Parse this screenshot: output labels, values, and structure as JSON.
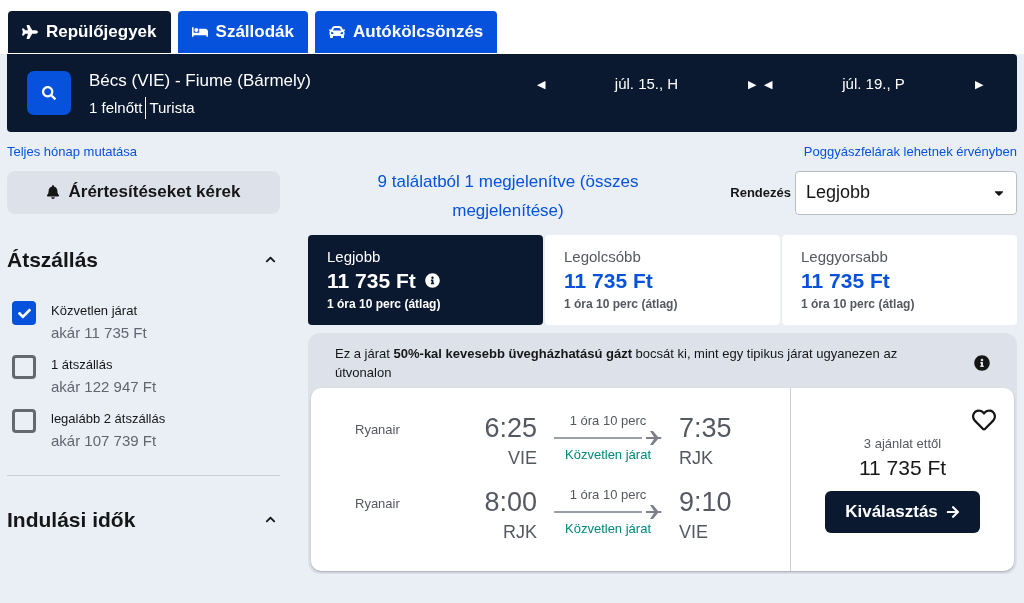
{
  "tabs": [
    {
      "label": "Repülőjegyek",
      "kind": "plane",
      "selected": true
    },
    {
      "label": "Szállodák",
      "kind": "bed",
      "selected": false
    },
    {
      "label": "Autókölcsönzés",
      "kind": "car",
      "selected": false
    }
  ],
  "search": {
    "route": "Bécs (VIE) - Fiume (Bármely)",
    "passengers": "1 felnőtt",
    "cabin": "Turista",
    "dates": [
      "júl. 15., H",
      "júl. 19., P"
    ],
    "prev": "◀",
    "next": "▶"
  },
  "links": {
    "month": "Teljes hónap mutatása",
    "baggage": "Poggyászfelárak lehetnek érvényben"
  },
  "alert_button": "Árértesítéseket kérek",
  "filters": [
    {
      "title": "Átszállás",
      "expanded": true,
      "options": [
        {
          "label": "Közvetlen járat",
          "price": "akár 11 735 Ft",
          "checked": true
        },
        {
          "label": "1 átszállás",
          "price": "akár 122 947 Ft",
          "checked": false
        },
        {
          "label": "legalább 2 átszállás",
          "price": "akár 107 739 Ft",
          "checked": false
        }
      ]
    },
    {
      "title": "Indulási idők",
      "expanded": true
    }
  ],
  "results_summary": "9 találatból 1 megjelenítve (összes megjelenítése)",
  "sort": {
    "label": "Rendezés",
    "value": "Legjobb"
  },
  "sort_tabs": [
    {
      "label": "Legjobb",
      "price": "11 735 Ft",
      "duration": "1 óra 10 perc (átlag)",
      "selected": true,
      "info": true
    },
    {
      "label": "Legolcsóbb",
      "price": "11 735 Ft",
      "duration": "1 óra 10 perc (átlag)",
      "selected": false,
      "info": false
    },
    {
      "label": "Leggyorsabb",
      "price": "11 735 Ft",
      "duration": "1 óra 10 perc (átlag)",
      "selected": false,
      "info": false
    }
  ],
  "eco_note": "Ez a járat **50%-kal kevesebb üvegházhatású gázt** bocsát ki, mint egy tipikus járat ugyanezen az útvonalon",
  "result": {
    "legs": [
      {
        "airline": "Ryanair",
        "dep_time": "6:25",
        "dep_airport": "VIE",
        "duration": "1 óra 10 perc",
        "stops": "Közvetlen járat",
        "arr_time": "7:35",
        "arr_airport": "RJK"
      },
      {
        "airline": "Ryanair",
        "dep_time": "8:00",
        "dep_airport": "RJK",
        "duration": "1 óra 10 perc",
        "stops": "Közvetlen járat",
        "arr_time": "9:10",
        "arr_airport": "VIE"
      }
    ],
    "offers": "3 ajánlat ettől",
    "price": "11 735 Ft",
    "button": "Kiválasztás",
    "favorite": false
  }
}
